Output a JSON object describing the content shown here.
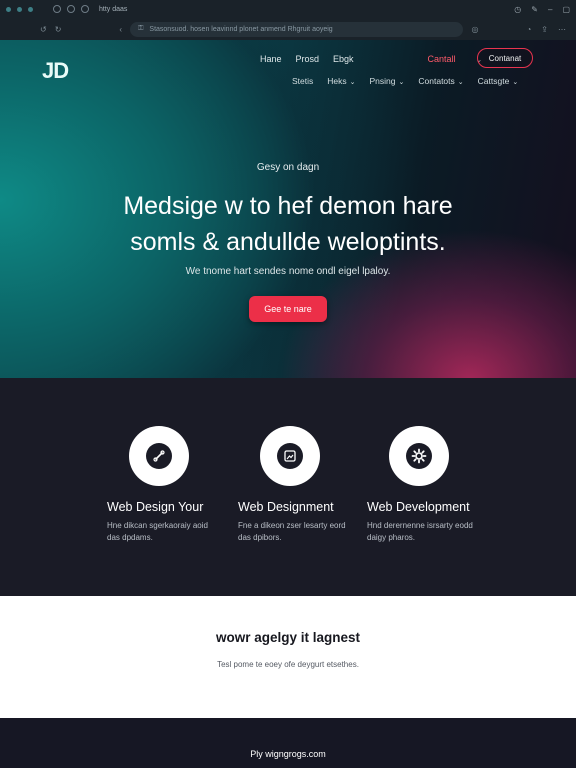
{
  "browser": {
    "tab_title": "htty daas",
    "url": "Stasonsuod. hosen leavinnd plonet anmend Rhgruit aoyeig",
    "icons": [
      "dot-icon",
      "dot-icon",
      "dot-icon",
      "shield-icon",
      "history-icon",
      "tab-icon",
      "back-icon",
      "refresh-icon",
      "lock-icon",
      "clock-icon",
      "extensions-icon",
      "menu-icon"
    ]
  },
  "nav": {
    "logo": "JD",
    "primary": [
      {
        "label": "Hane"
      },
      {
        "label": "Prosd"
      },
      {
        "label": "Ebgk"
      }
    ],
    "contact_link": "Cantall",
    "cta": "Contanat",
    "secondary": [
      {
        "label": "Stetis",
        "chevron": ""
      },
      {
        "label": "Heks",
        "chevron": "⌄"
      },
      {
        "label": "Pnsing",
        "chevron": "⌄"
      },
      {
        "label": "Contatots",
        "chevron": "⌄"
      },
      {
        "label": "Cattsgte",
        "chevron": "⌄"
      }
    ]
  },
  "hero": {
    "eyebrow": "Gesy on dagn",
    "headline_line1": "Medsige w to hef demon hare",
    "headline_line2": "somls & andullde weloptints.",
    "subline": "We tnome hart sendes nome ondl eigel lpaloy.",
    "button": "Gee te nare"
  },
  "services": [
    {
      "title": "Web Design Your",
      "desc": "Hne dikcan sgerkaoraiy aoid das dpdams.",
      "icon": "link-icon"
    },
    {
      "title": "Web Designment",
      "desc": "Fne a dikeon zser lesarty eord das dpibors.",
      "icon": "image-frame-icon"
    },
    {
      "title": "Web Development",
      "desc": "Hnd derernenne isrsarty eodd daigy pharos.",
      "icon": "gear-icon"
    }
  ],
  "tagline": {
    "heading": "wowr agelgy it lagnest",
    "text": "Tesl pome te eoey ofe deygurt etsethes."
  },
  "footer": {
    "text": "Ply wigngrogs.com"
  },
  "colors": {
    "accent": "#ec2f48",
    "teal": "#0e8a86",
    "dark": "#1a1b26"
  }
}
